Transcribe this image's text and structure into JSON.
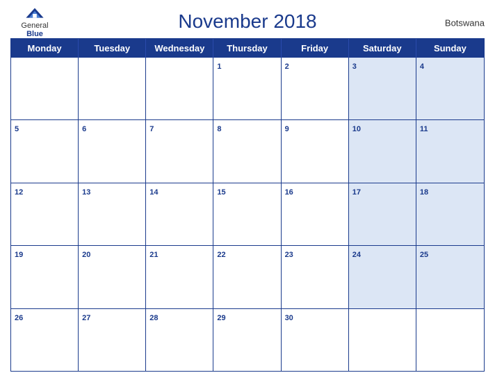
{
  "header": {
    "title": "November 2018",
    "country": "Botswana",
    "logo": {
      "general": "General",
      "blue": "Blue"
    }
  },
  "days": {
    "headers": [
      "Monday",
      "Tuesday",
      "Wednesday",
      "Thursday",
      "Friday",
      "Saturday",
      "Sunday"
    ]
  },
  "weeks": [
    [
      {
        "day": "",
        "weekend": false,
        "empty": true
      },
      {
        "day": "",
        "weekend": false,
        "empty": true
      },
      {
        "day": "",
        "weekend": false,
        "empty": true
      },
      {
        "day": "1",
        "weekend": false,
        "empty": false
      },
      {
        "day": "2",
        "weekend": false,
        "empty": false
      },
      {
        "day": "3",
        "weekend": true,
        "empty": false
      },
      {
        "day": "4",
        "weekend": true,
        "empty": false
      }
    ],
    [
      {
        "day": "5",
        "weekend": false,
        "empty": false
      },
      {
        "day": "6",
        "weekend": false,
        "empty": false
      },
      {
        "day": "7",
        "weekend": false,
        "empty": false
      },
      {
        "day": "8",
        "weekend": false,
        "empty": false
      },
      {
        "day": "9",
        "weekend": false,
        "empty": false
      },
      {
        "day": "10",
        "weekend": true,
        "empty": false
      },
      {
        "day": "11",
        "weekend": true,
        "empty": false
      }
    ],
    [
      {
        "day": "12",
        "weekend": false,
        "empty": false
      },
      {
        "day": "13",
        "weekend": false,
        "empty": false
      },
      {
        "day": "14",
        "weekend": false,
        "empty": false
      },
      {
        "day": "15",
        "weekend": false,
        "empty": false
      },
      {
        "day": "16",
        "weekend": false,
        "empty": false
      },
      {
        "day": "17",
        "weekend": true,
        "empty": false
      },
      {
        "day": "18",
        "weekend": true,
        "empty": false
      }
    ],
    [
      {
        "day": "19",
        "weekend": false,
        "empty": false
      },
      {
        "day": "20",
        "weekend": false,
        "empty": false
      },
      {
        "day": "21",
        "weekend": false,
        "empty": false
      },
      {
        "day": "22",
        "weekend": false,
        "empty": false
      },
      {
        "day": "23",
        "weekend": false,
        "empty": false
      },
      {
        "day": "24",
        "weekend": true,
        "empty": false
      },
      {
        "day": "25",
        "weekend": true,
        "empty": false
      }
    ],
    [
      {
        "day": "26",
        "weekend": false,
        "empty": false
      },
      {
        "day": "27",
        "weekend": false,
        "empty": false
      },
      {
        "day": "28",
        "weekend": false,
        "empty": false
      },
      {
        "day": "29",
        "weekend": false,
        "empty": false
      },
      {
        "day": "30",
        "weekend": false,
        "empty": false
      },
      {
        "day": "",
        "weekend": true,
        "empty": true
      },
      {
        "day": "",
        "weekend": true,
        "empty": true
      }
    ]
  ]
}
